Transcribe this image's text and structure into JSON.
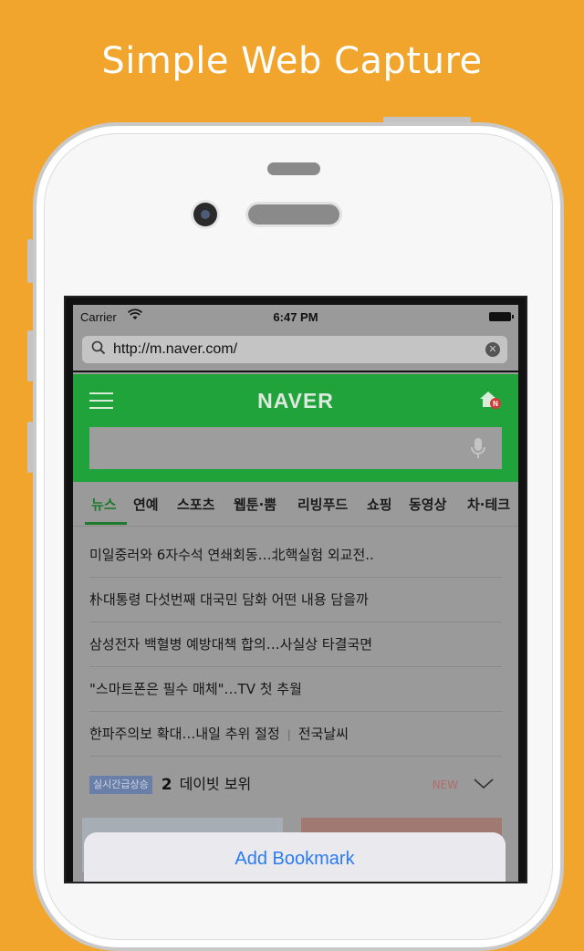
{
  "headline": "Simple Web Capture",
  "status_bar": {
    "carrier": "Carrier",
    "time": "6:47 PM"
  },
  "browser": {
    "url": "http://m.naver.com/"
  },
  "naver": {
    "logo": "NAVER",
    "home_badge": "N",
    "tabs": [
      "뉴스",
      "연예",
      "스포츠",
      "웹툰·뿜",
      "리빙푸드",
      "쇼핑",
      "동영상",
      "차·테크"
    ],
    "active_tab": "뉴스",
    "news": [
      "미일중러와 6자수석 연쇄회동…北핵실험 외교전..",
      "朴대통령 다섯번째 대국민 담화 어떤 내용 담을까",
      "삼성전자 백혈병 예방대책 합의…사실상 타결국면",
      "\"스마트폰은 필수 매체\"…TV 첫 추월",
      "한파주의보 확대…내일 추위 절정"
    ],
    "news_extra": "전국날씨",
    "trending": {
      "badge": "실시간급상승",
      "rank": "2",
      "text": "데이빗 보위",
      "new_label": "NEW"
    }
  },
  "action_sheet": {
    "add_bookmark": "Add Bookmark"
  },
  "colors": {
    "background": "#F2A52D",
    "naver_green": "#20A33A",
    "ios_blue": "#2b7bf2"
  }
}
